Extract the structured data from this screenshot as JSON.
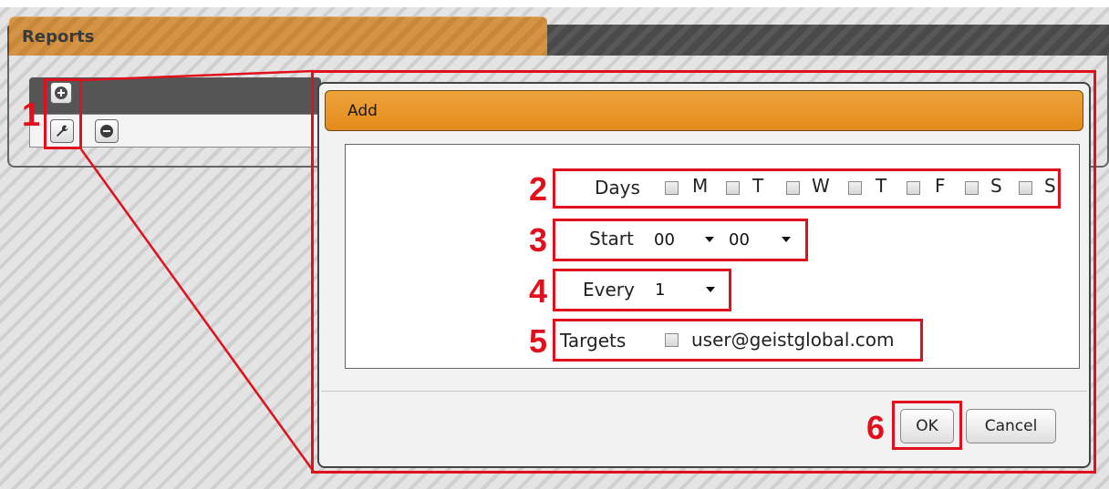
{
  "reports": {
    "title": "Reports"
  },
  "dialog": {
    "title": "Add",
    "days_label": "Days",
    "days": [
      "M",
      "T",
      "W",
      "T",
      "F",
      "S",
      "S"
    ],
    "start_label": "Start",
    "start_hour": "00",
    "start_minute": "00",
    "every_label": "Every",
    "every_value": "1",
    "targets_label": "Targets",
    "target_email": "user@geistglobal.com",
    "ok_label": "OK",
    "cancel_label": "Cancel"
  },
  "annotations": [
    "1",
    "2",
    "3",
    "4",
    "5",
    "6"
  ],
  "icons": {
    "add": "plus-circle-icon",
    "edit": "wrench-icon",
    "remove": "minus-circle-icon"
  },
  "colors": {
    "accent": "#e48b1c",
    "annotation": "#e0101c",
    "tab": "#d49444"
  }
}
